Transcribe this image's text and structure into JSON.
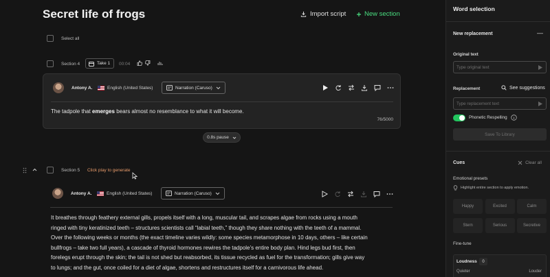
{
  "header": {
    "title": "Secret life of frogs",
    "more_label": "···",
    "import_label": "Import script",
    "new_section_label": "New section"
  },
  "select_all_label": "Select all",
  "section4": {
    "label": "Section 4",
    "take_label": "Take 1",
    "time": "00:04",
    "speaker": "Antony A.",
    "language": "English (United States)",
    "voice": "Narration (Caruso)",
    "text_before": "The tadpole that ",
    "text_bold": "emerges",
    "text_after": " bears almost no resemblance to what it will become.",
    "counter": "76/5000"
  },
  "pause_label": "0.8s pause",
  "section5": {
    "label": "Section 5",
    "hint": "Click play to generate",
    "speaker": "Antony A.",
    "language": "English (United States)",
    "voice": "Narration (Caruso)",
    "lines": [
      "It breathes through feathery external gills, propels itself with a long, muscular tail, and scrapes algae from rocks using a mouth",
      "ringed with tiny keratinized teeth – structures scientists call “labial teeth,” though they share nothing with the teeth of a mammal.",
      "Over the following weeks or months (the exact timeline varies wildly: some species metamorphose in 10 days, others – like certain",
      "bullfrogs – take two full years), a cascade of thyroid hormones rewires the tadpole’s entire body plan. Hind legs bud first, then",
      "forelegs erupt through the skin; the tail is not shed but reabsorbed, its tissue recycled as fuel for the transformation; gills give way",
      "to lungs; and the gut, once coiled for a diet of algae, shortens and restructures itself for a carnivorous life ahead."
    ]
  },
  "panel": {
    "title": "Word selection",
    "new_replacement": "New replacement",
    "collapse_label": "—",
    "original_label": "Original text",
    "original_placeholder": "Type original text",
    "replacement_label": "Replacement",
    "see_suggestions": "See suggestions",
    "replacement_placeholder": "Type replacement text",
    "phonetic_label": "Phonetic Respelling",
    "phonetic_enabled": true,
    "save_label": "Save To Library",
    "cues_title": "Cues",
    "clear_all": "Clear all",
    "emotional_presets": "Emotional presets",
    "highlight_hint": "Highlight entire section to apply emotion.",
    "presets": [
      "Happy",
      "Excited",
      "Calm",
      "Stern",
      "Serious",
      "Secretive"
    ],
    "fine_tune": "Fine-tune",
    "loudness_label": "Loudness",
    "loudness_value": "0",
    "quieter": "Quieter",
    "louder": "Louder"
  },
  "colors": {
    "accent_green": "#4ade80",
    "toggle_green": "#22c55e",
    "hint_orange": "#e69a6a",
    "background": "#151515",
    "panel": "#1b1b1b"
  }
}
